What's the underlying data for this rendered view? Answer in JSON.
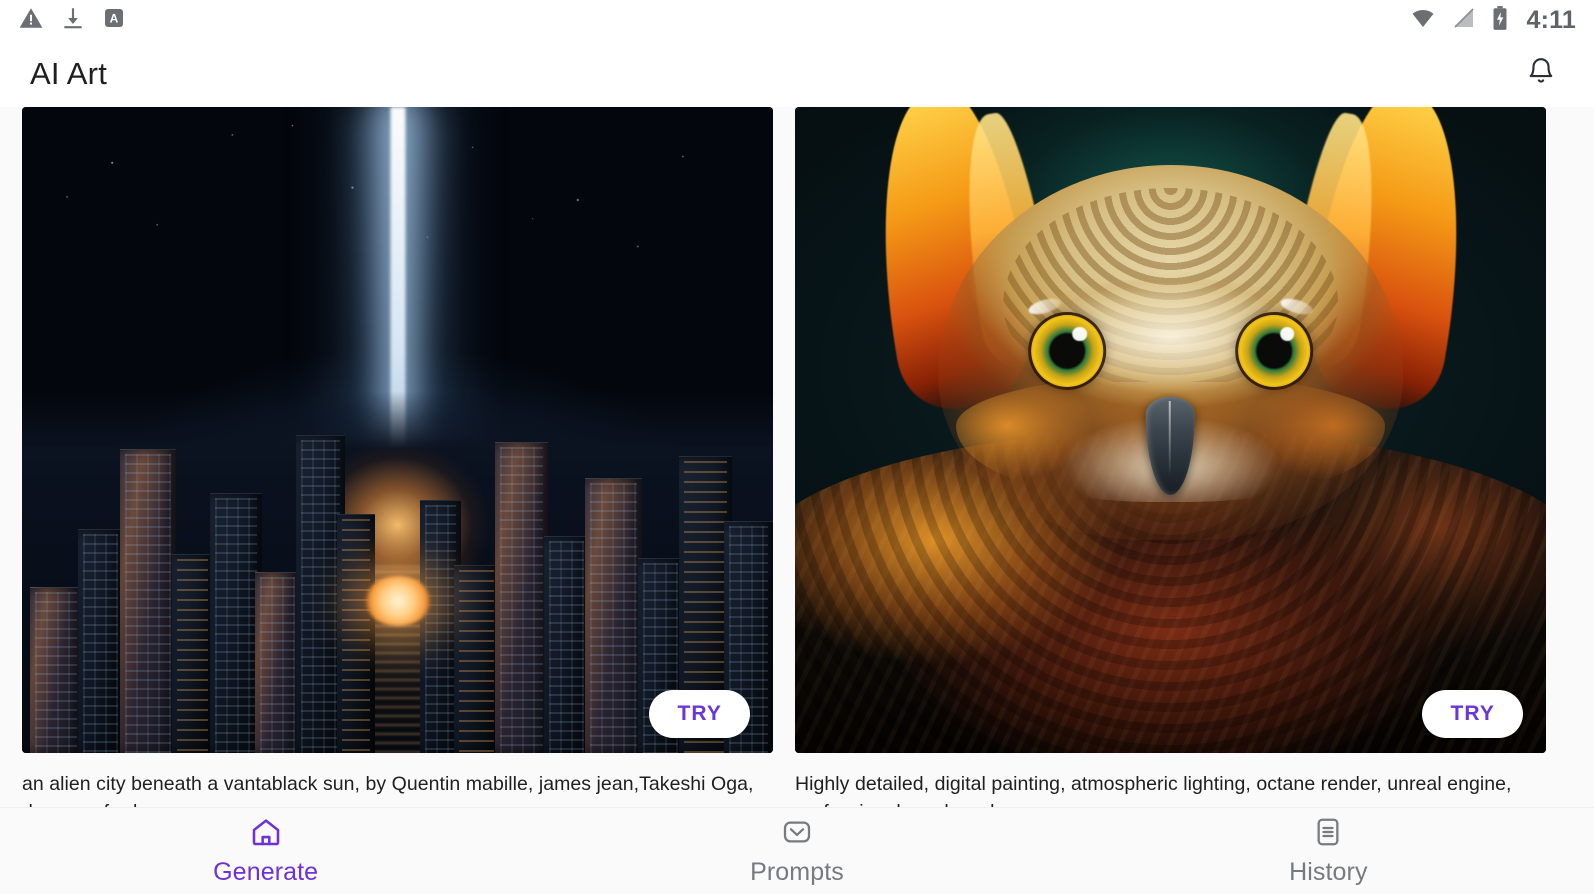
{
  "status_bar": {
    "icons_left": [
      "warning-triangle-icon",
      "download-icon",
      "app-a-icon"
    ],
    "icons_right": [
      "wifi-icon",
      "signal-off-icon",
      "battery-charging-icon"
    ],
    "time": "4:11"
  },
  "app_bar": {
    "title": "AI Art",
    "notification_icon": "bell-icon"
  },
  "cards": [
    {
      "image_alt": "alien city beneath a vantablack sun",
      "try_label": "TRY",
      "caption": "an alien city beneath a vantablack sun, by Quentin mabille, james jean,Takeshi Oga, dan mumford, eve"
    },
    {
      "image_alt": "eagle owl portrait digital painting",
      "try_label": "TRY",
      "caption": "Highly detailed, digital painting, atmospheric lighting, octane render, unreal engine, professional, eagle owl"
    }
  ],
  "bottom_nav": {
    "items": [
      {
        "label": "Generate",
        "icon": "home-icon",
        "active": true
      },
      {
        "label": "Prompts",
        "icon": "envelope-icon",
        "active": false
      },
      {
        "label": "History",
        "icon": "document-list-icon",
        "active": false
      }
    ]
  },
  "colors": {
    "accent": "#7030d8",
    "try_text": "#6a35d9",
    "inactive": "#767b80",
    "background": "#fafafa",
    "surface": "#ffffff"
  }
}
